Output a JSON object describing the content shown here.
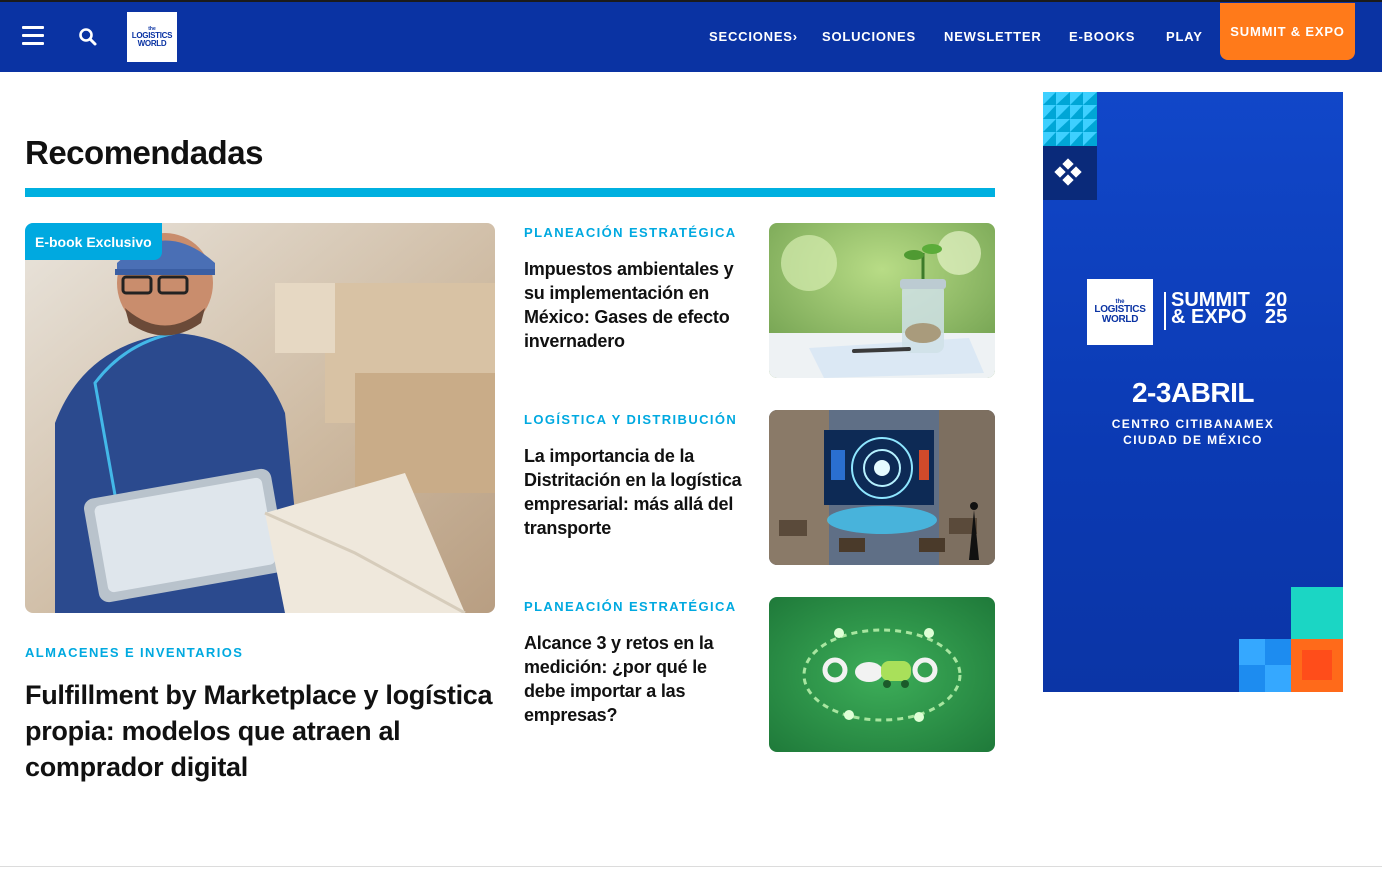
{
  "header": {
    "logo": {
      "line1": "the",
      "line2": "LOGISTICS",
      "line3": "WORLD"
    },
    "nav": [
      {
        "label": "SECCIONES",
        "has_chevron": true
      },
      {
        "label": "SOLUCIONES"
      },
      {
        "label": "NEWSLETTER"
      },
      {
        "label": "E-BOOKS"
      },
      {
        "label": "PLAY"
      }
    ],
    "cta": "SUMMIT & EXPO",
    "icons": [
      "menu-icon",
      "search-icon"
    ]
  },
  "section": {
    "title": "Recomendadas"
  },
  "featured": {
    "badge": "E-book Exclusivo",
    "category": "ALMACENES E INVENTARIOS",
    "title": "Fulfillment by Marketplace y logística propia: modelos que atraen al comprador digital"
  },
  "articles": [
    {
      "category": "PLANEACIÓN ESTRATÉGICA",
      "title": "Impuestos ambientales y su implementación en México: Gases de efecto invernadero"
    },
    {
      "category": "LOGÍSTICA Y DISTRIBUCIÓN",
      "title": "La importancia de la Distritación en la logística empresarial: más allá del transporte"
    },
    {
      "category": "PLANEACIÓN ESTRATÉGICA",
      "title": "Alcance 3 y retos en la medición: ¿por qué le debe importar a las empresas?"
    }
  ],
  "ad": {
    "logo": {
      "line1": "the",
      "line2": "LOGISTICS",
      "line3": "WORLD"
    },
    "summit_line1": "SUMMIT",
    "summit_line2": "& EXPO",
    "year_line1": "20",
    "year_line2": "25",
    "date": "2-3ABRIL",
    "venue_line1": "CENTRO CITIBANAMEX",
    "venue_line2": "CIUDAD DE MÉXICO"
  },
  "colors": {
    "header_bg": "#0a33a3",
    "cta_bg": "#ff7a1a",
    "accent": "#00a9e0",
    "rule": "#00b0e0"
  }
}
